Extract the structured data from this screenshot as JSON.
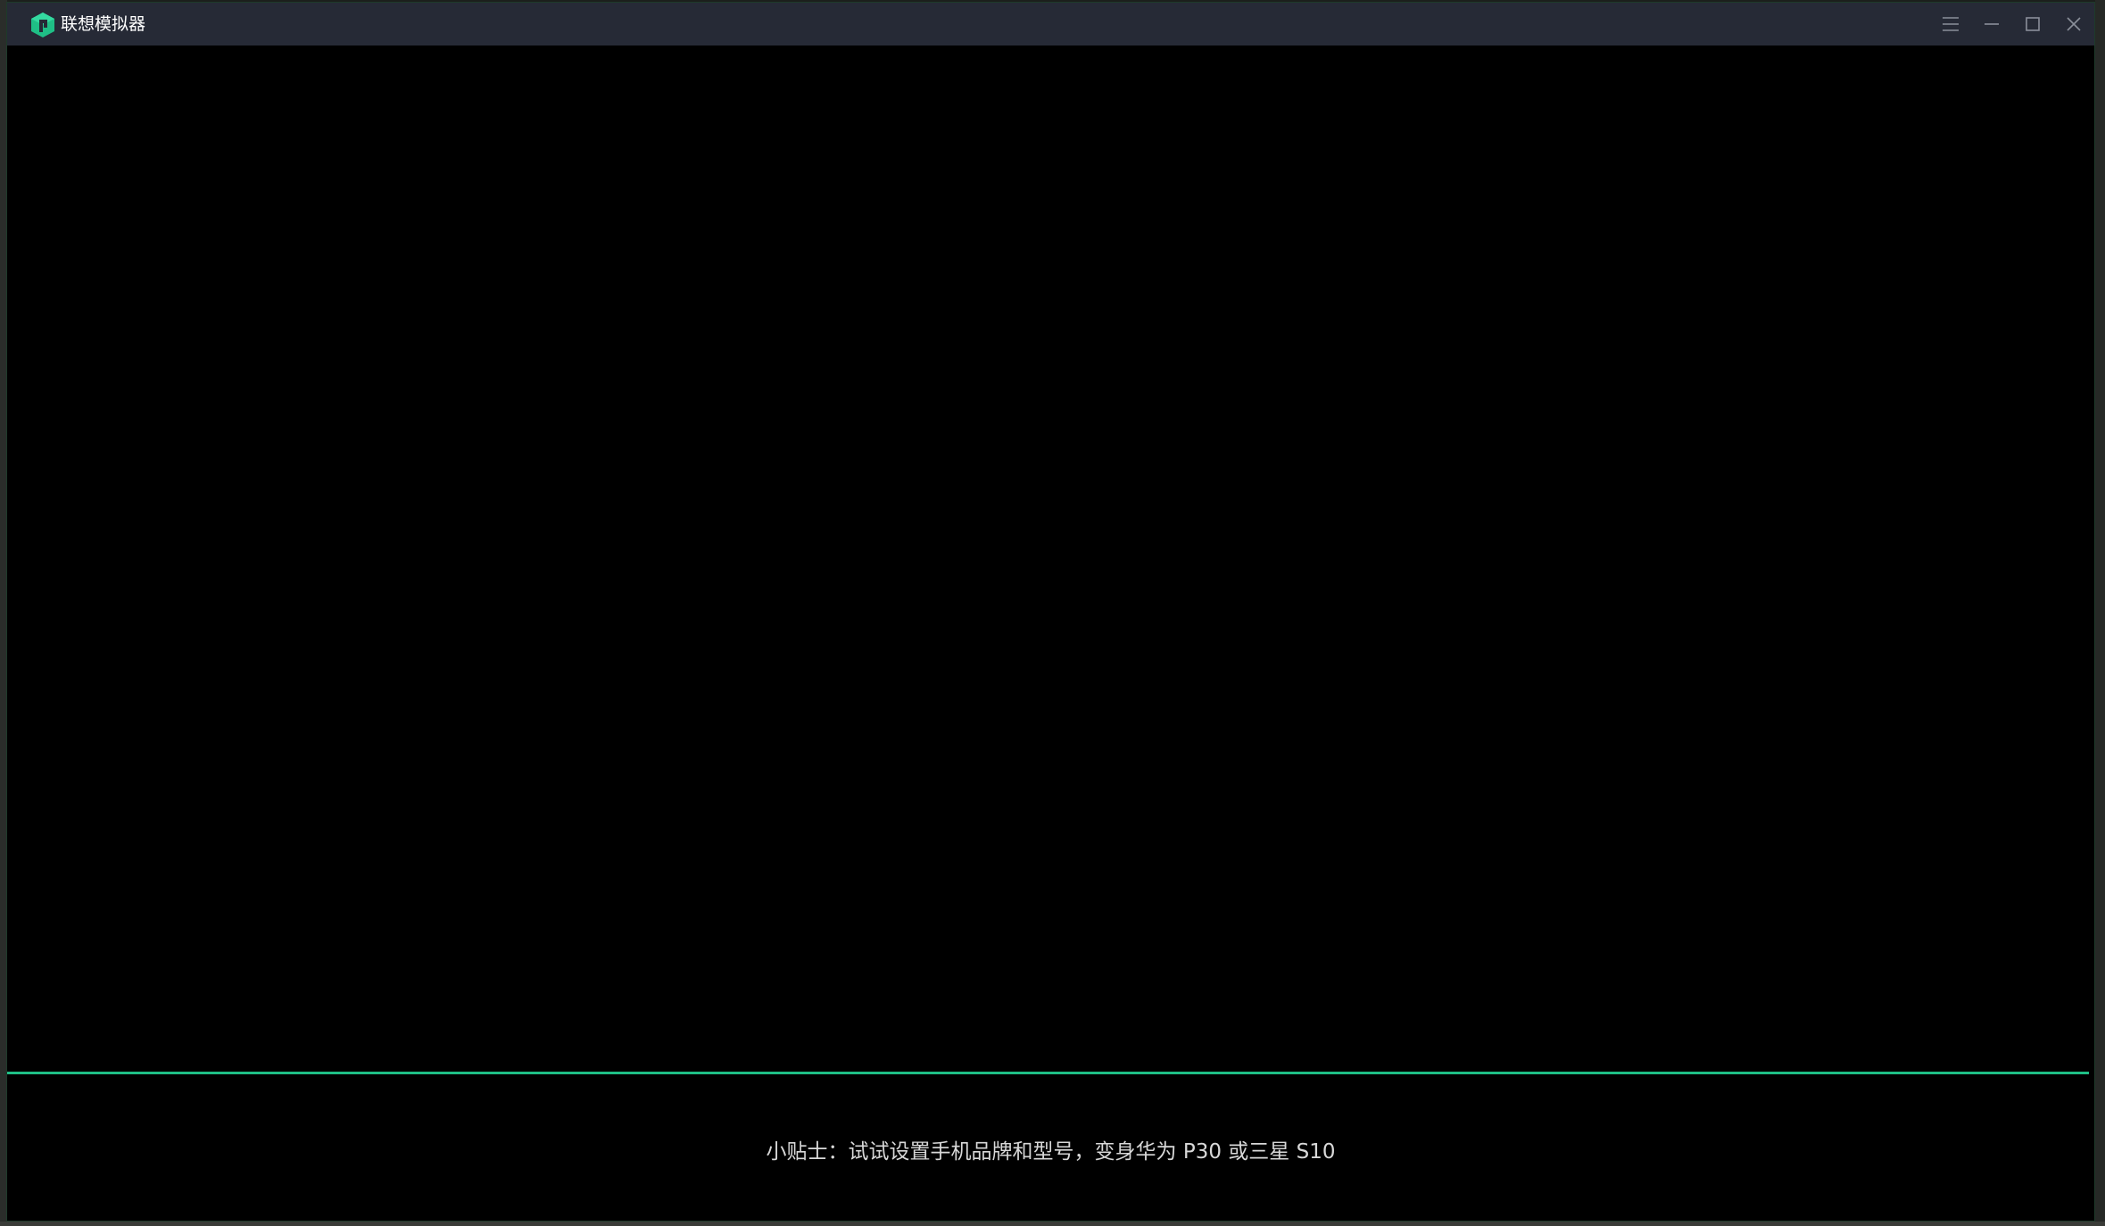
{
  "window": {
    "title": "联想模拟器",
    "accent_color": "#1fbf86",
    "titlebar_color": "#262a36"
  },
  "controls": {
    "menu_icon": "menu-icon",
    "minimize_icon": "minimize-icon",
    "maximize_icon": "maximize-icon",
    "close_icon": "close-icon"
  },
  "loading": {
    "progress": 1.0
  },
  "footer": {
    "tip": "小贴士：试试设置手机品牌和型号，变身华为 P30 或三星 S10"
  }
}
